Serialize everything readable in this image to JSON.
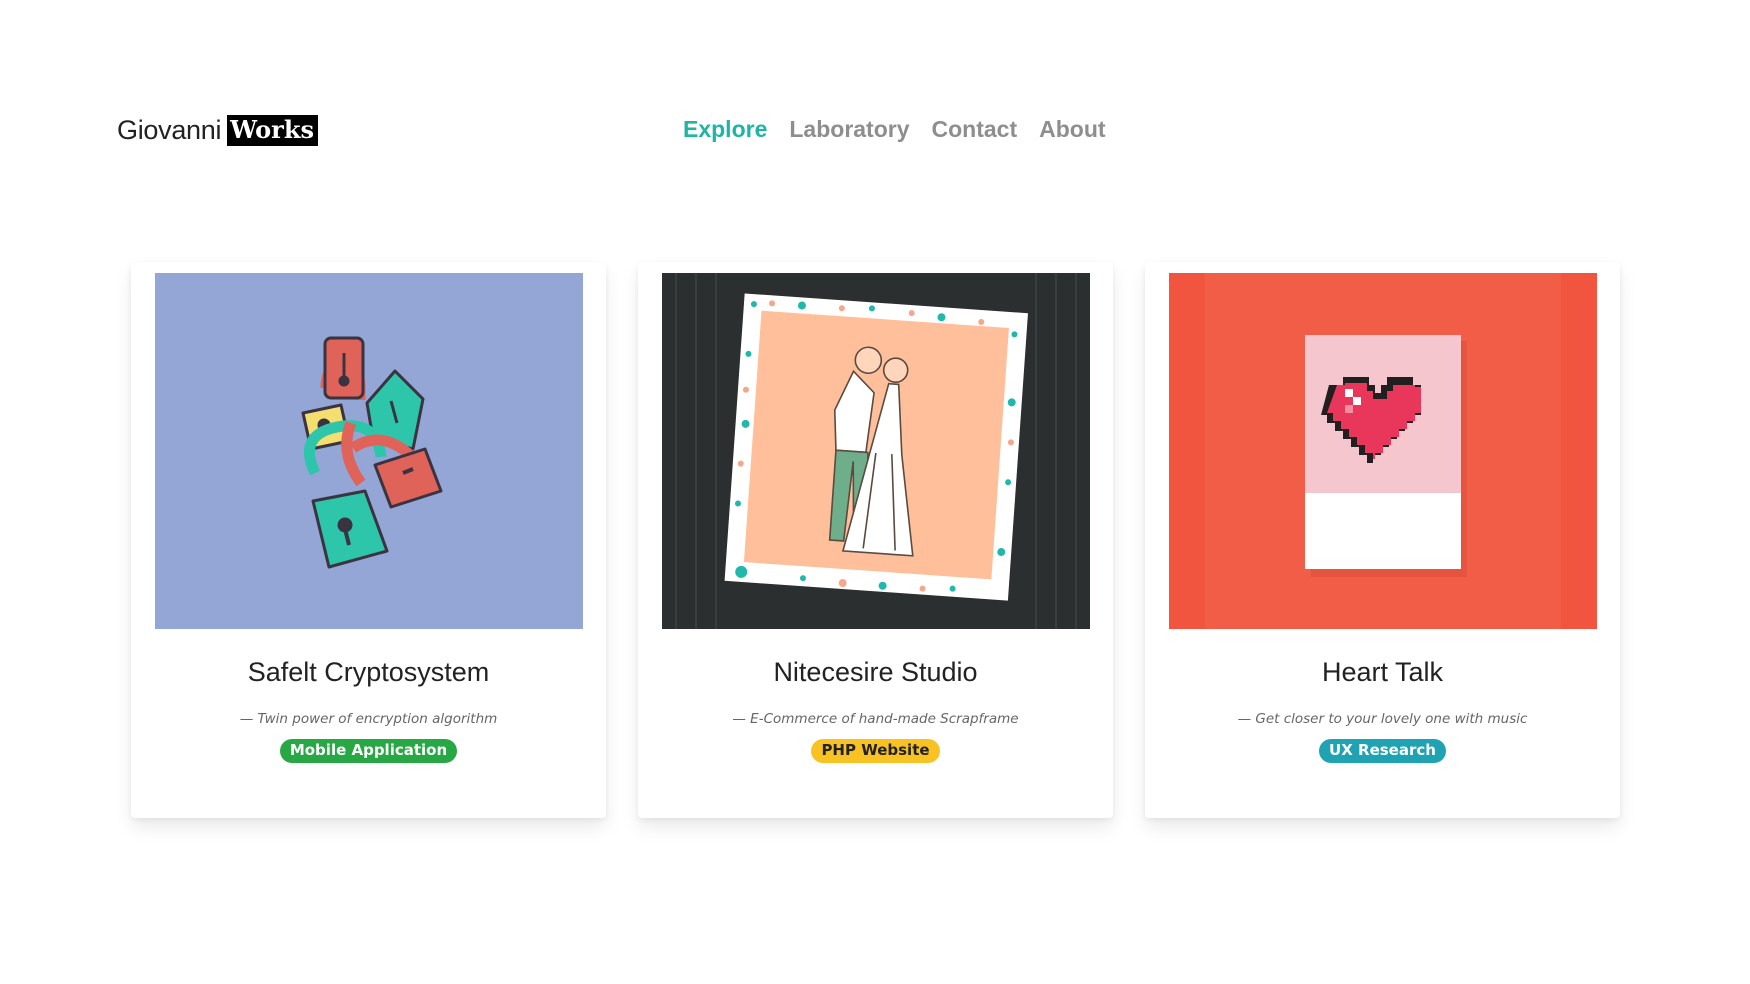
{
  "brand": {
    "name": "Giovanni",
    "accent": "Works"
  },
  "nav": [
    {
      "label": "Explore",
      "active": true
    },
    {
      "label": "Laboratory",
      "active": false
    },
    {
      "label": "Contact",
      "active": false
    },
    {
      "label": "About",
      "active": false
    }
  ],
  "colors": {
    "accent": "#1eb5a4",
    "nav_inactive": "#8e8e8e",
    "badge_green": "#28a745",
    "badge_yellow": "#f8c322",
    "badge_teal": "#1fa3b3"
  },
  "projects": [
    {
      "title": "Safelt Cryptosystem",
      "subtitle": "— Twin power of encryption algorithm",
      "tag": "Mobile Application",
      "image": "padlocks-illustration"
    },
    {
      "title": "Nitecesire Studio",
      "subtitle": "— E-Commerce of hand-made Scrapframe",
      "tag": "PHP Website",
      "image": "wedding-scrapframe-photo"
    },
    {
      "title": "Heart Talk",
      "subtitle": "— Get closer to your lovely one with music",
      "tag": "UX Research",
      "image": "pixel-heart-card-photo"
    }
  ]
}
